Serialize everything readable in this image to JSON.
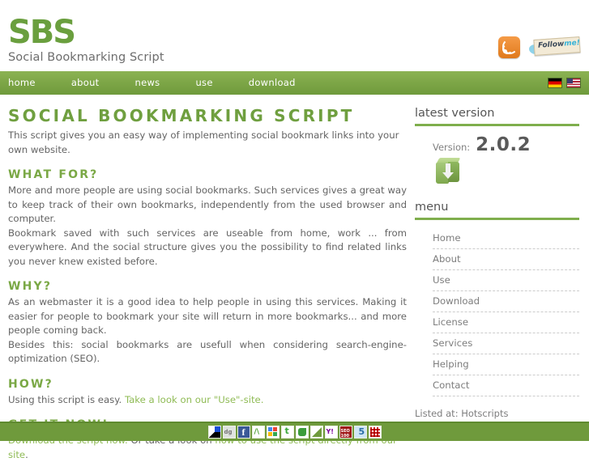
{
  "header": {
    "logo_main": "SBS",
    "logo_sub": "Social Bookmarking Script",
    "rss_icon": "rss-icon",
    "follow_icon": "followme-icon",
    "follow_text_a": "Follow",
    "follow_text_b": "me!"
  },
  "nav": {
    "items": [
      {
        "label": "home"
      },
      {
        "label": "about"
      },
      {
        "label": "news"
      },
      {
        "label": "use"
      },
      {
        "label": "download"
      }
    ],
    "languages": [
      {
        "name": "german-flag",
        "title": "Deutsch"
      },
      {
        "name": "us-flag",
        "title": "English"
      }
    ]
  },
  "main": {
    "title": "SOCIAL BOOKMARKING SCRIPT",
    "intro": "This script gives you an easy way of implementing social bookmark links into your own website.",
    "sections": [
      {
        "heading": "WHAT FOR?",
        "paragraphs": [
          "More and more people are using social bookmarks. Such services gives a great way to keep track of their own bookmarks, independently from the used browser and computer.",
          "Bookmark saved with such services are useable from home, work ... from everywhere. And the social structure gives you the possibility to find related links you never knew existed before."
        ]
      },
      {
        "heading": "WHY?",
        "paragraphs": [
          "As an webmaster it is a good idea to help people in using this services. Making it easier for people to bookmark your site will return in more bookmarks... and more people coming back.",
          "Besides this: social bookmarks are usefull when considering search-engine-optimization (SEO)."
        ]
      },
      {
        "heading": "HOW?",
        "lead": "Using this script is easy.",
        "link": "Take a look on our \"Use\"-site.",
        "tail": ""
      },
      {
        "heading": "GET IT NOW!",
        "link1": "Download the script now.",
        "mid": " Or take a look on ",
        "link2": "how to use the script directly from our site",
        "tail": "."
      }
    ]
  },
  "sidebar": {
    "version_heading": "latest version",
    "version_label": "Version:",
    "version_number": "2.0.2",
    "download_icon": "download-box-icon",
    "menu_heading": "menu",
    "menu_items": [
      {
        "label": "Home"
      },
      {
        "label": "About"
      },
      {
        "label": "Use"
      },
      {
        "label": "Download"
      },
      {
        "label": "License"
      },
      {
        "label": "Services"
      },
      {
        "label": "Helping"
      },
      {
        "label": "Contact"
      }
    ],
    "listed_prefix": "Listed at: ",
    "listed_link": "Hotscripts"
  },
  "footer": {
    "bookmarks": [
      {
        "name": "delicious-bookmark-icon",
        "cls": "bm-delicious"
      },
      {
        "name": "digg-bookmark-icon",
        "cls": "bm-digg"
      },
      {
        "name": "facebook-bookmark-icon",
        "cls": "bm-facebook"
      },
      {
        "name": "mister-wong-bookmark-icon",
        "cls": "bm-mister"
      },
      {
        "name": "google-bookmark-icon",
        "cls": "bm-google"
      },
      {
        "name": "technorati-bookmark-icon",
        "cls": "bm-tech"
      },
      {
        "name": "webnews-bookmark-icon",
        "cls": "bm-green"
      },
      {
        "name": "folkd-bookmark-icon",
        "cls": "bm-tri"
      },
      {
        "name": "yahoo-bookmark-icon",
        "cls": "bm-yahoo"
      },
      {
        "name": "seo100-bookmark-icon",
        "cls": "bm-seo"
      },
      {
        "name": "favoriten-bookmark-icon",
        "cls": "bm-five"
      },
      {
        "name": "qr-bookmark-icon",
        "cls": "bm-qr"
      }
    ]
  },
  "colors": {
    "brand_green": "#6f9f3f",
    "nav_green": "#7da647",
    "link_green": "#8fbb55",
    "body_text": "#646464",
    "footer_green": "#6f9a3c"
  }
}
